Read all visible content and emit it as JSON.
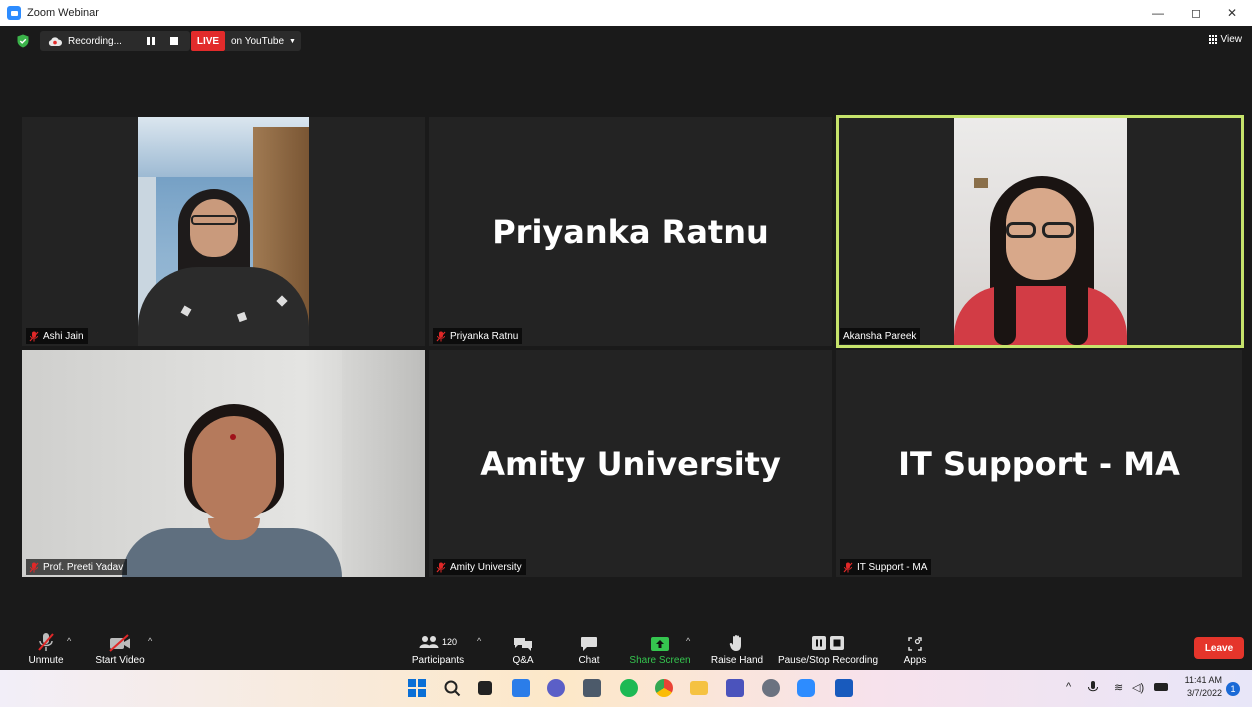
{
  "window": {
    "title": "Zoom Webinar",
    "minimize": "—",
    "restore": "◻",
    "close": "✕"
  },
  "topbar": {
    "recording_label": "Recording...",
    "live_label": "LIVE",
    "stream_target": "on YouTube",
    "view_label": "View"
  },
  "tiles": [
    {
      "name": "Ashi Jain",
      "muted": true
    },
    {
      "name": "Priyanka Ratnu",
      "display": "Priyanka Ratnu",
      "muted": true
    },
    {
      "name": "Akansha Pareek",
      "muted": false,
      "active": true
    },
    {
      "name": "Prof. Preeti Yadav",
      "muted": true
    },
    {
      "name": "Amity University",
      "display": "Amity University",
      "muted": true
    },
    {
      "name": "IT Support - MA",
      "display": "IT Support - MA",
      "muted": true
    }
  ],
  "toolbar": {
    "unmute": "Unmute",
    "start_video": "Start Video",
    "participants": "Participants",
    "participant_count": "120",
    "qa": "Q&A",
    "chat": "Chat",
    "share_screen": "Share Screen",
    "raise_hand": "Raise Hand",
    "pause_stop_recording": "Pause/Stop Recording",
    "apps": "Apps",
    "leave": "Leave"
  },
  "taskbar": {
    "time": "11:41 AM",
    "date": "3/7/2022",
    "notifications": "1"
  },
  "colors": {
    "active_speaker_border": "#c6e36b",
    "leave_red": "#e5352b",
    "share_green": "#35c54f",
    "live_red": "#e22b2b",
    "muted_red": "#e02828"
  }
}
